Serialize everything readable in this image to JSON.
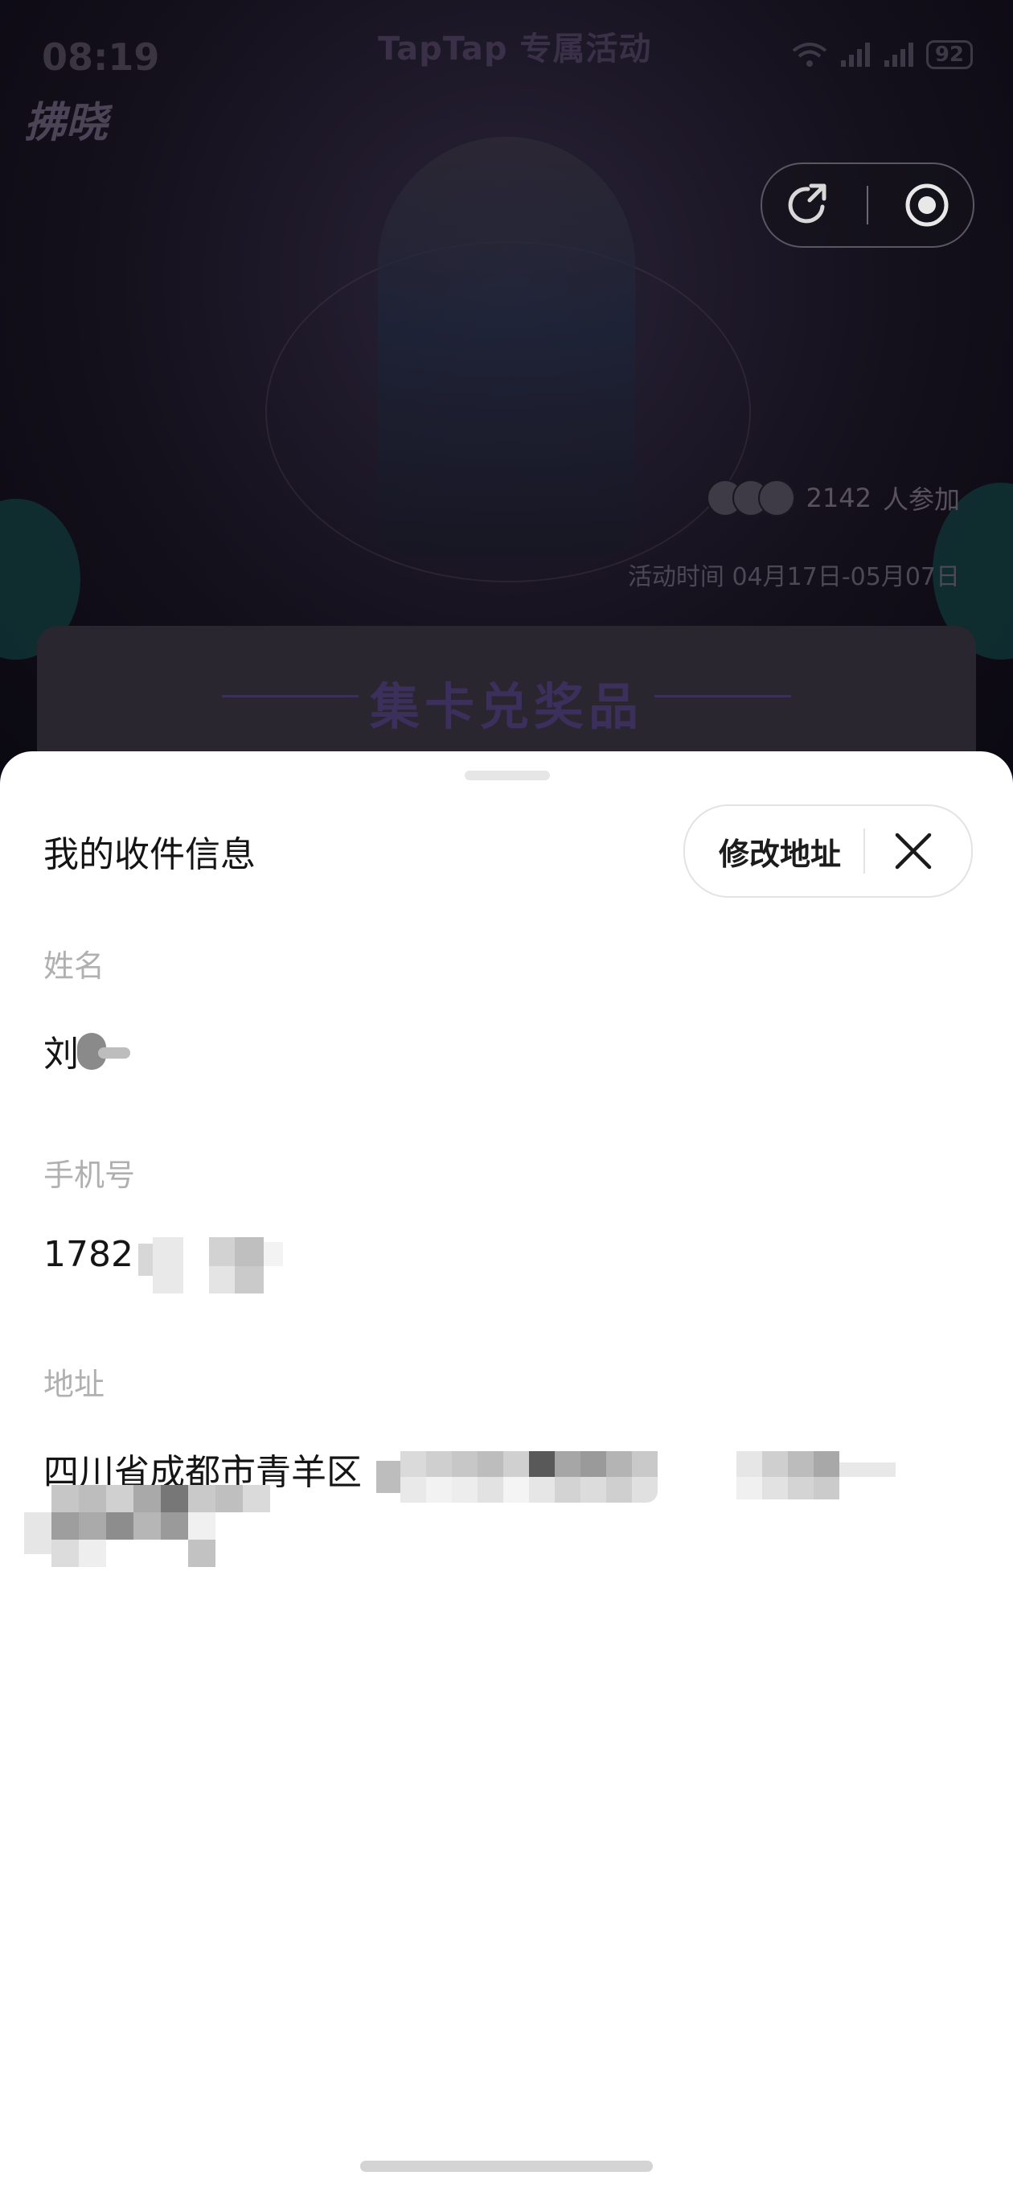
{
  "status_bar": {
    "time": "08:19",
    "page_title": "TapTap 专属活动",
    "battery": "92"
  },
  "background": {
    "game_logo": "拂晓",
    "participants_count": "2142",
    "participants_suffix": "人参加",
    "activity_time": "活动时间 04月17日-05月07日",
    "card_section_title": "集卡兑奖品"
  },
  "icons": {
    "share": "share-icon",
    "record": "record-icon",
    "close": "close-icon"
  },
  "sheet": {
    "title": "我的收件信息",
    "edit_button": "修改地址",
    "fields": [
      {
        "label": "姓名",
        "value": "刘"
      },
      {
        "label": "手机号",
        "value": "1782"
      },
      {
        "label": "地址",
        "value": "四川省成都市青羊区"
      }
    ]
  },
  "colors": {
    "sheet_bg": "#ffffff",
    "label_gray": "#b0b0b0",
    "text_dark": "#151515",
    "accent_purple": "#3b2f5c"
  }
}
